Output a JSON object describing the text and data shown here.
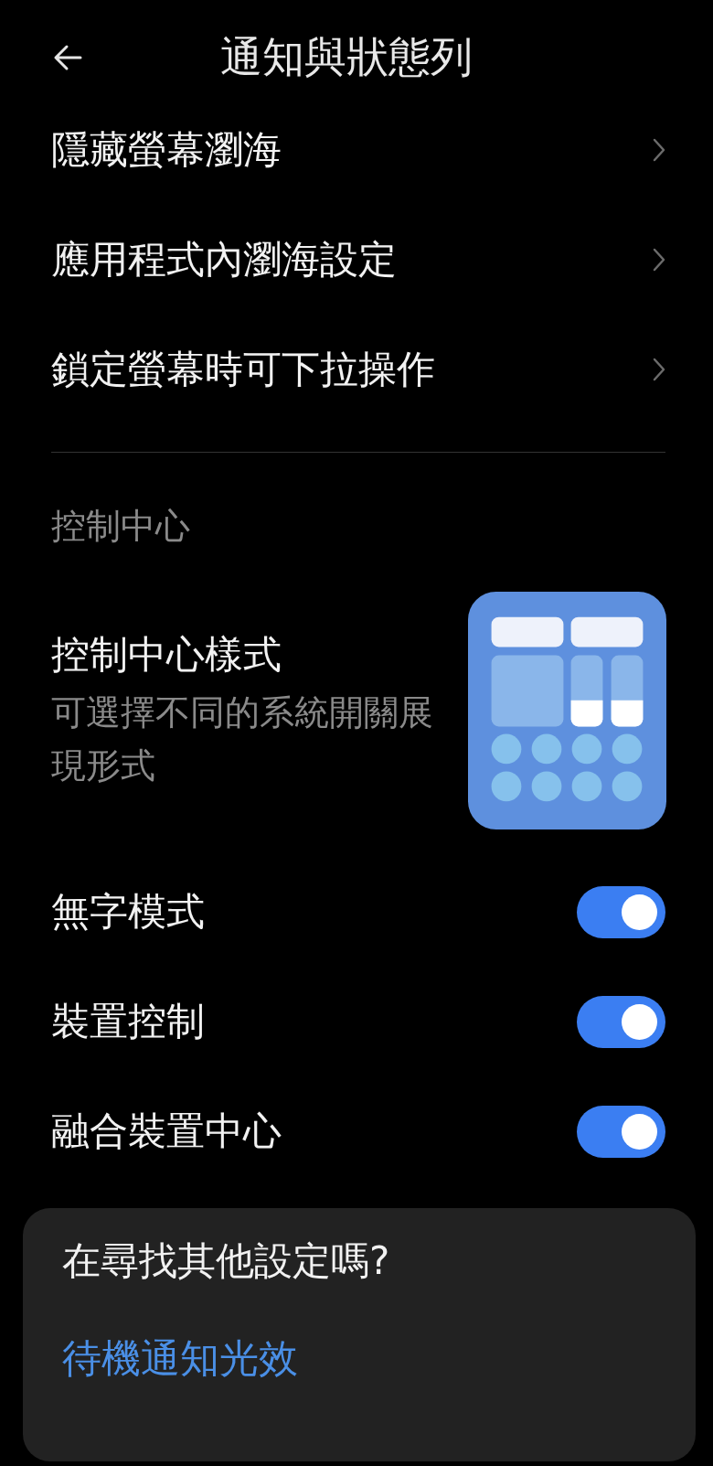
{
  "header": {
    "title": "通知與狀態列"
  },
  "nav_items": [
    {
      "label": "隱藏螢幕瀏海"
    },
    {
      "label": "應用程式內瀏海設定"
    },
    {
      "label": "鎖定螢幕時可下拉操作"
    }
  ],
  "section": {
    "title": "控制中心"
  },
  "style_option": {
    "title": "控制中心樣式",
    "description": "可選擇不同的系統開關展現形式"
  },
  "toggles": [
    {
      "label": "無字模式",
      "on": true
    },
    {
      "label": "裝置控制",
      "on": true
    },
    {
      "label": "融合裝置中心",
      "on": true
    }
  ],
  "card": {
    "title": "在尋找其他設定嗎?",
    "link": "待機通知光效"
  }
}
